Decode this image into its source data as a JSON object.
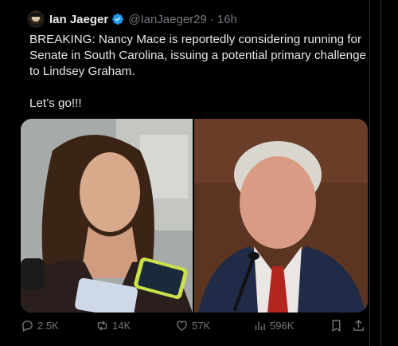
{
  "author": {
    "name": "Ian Jaeger",
    "handle": "@IanJaeger29",
    "separator": "·",
    "time": "16h"
  },
  "tweet": {
    "paragraph1": "BREAKING: Nancy Mace is reportedly considering running for Senate in South Carolina, issuing a potential primary challenge to Lindsey Graham.",
    "paragraph2": "Let’s go!!!"
  },
  "media": {
    "left_photo": "woman-speaking-to-reporters-photo",
    "right_photo": "man-at-hearing-photo"
  },
  "actions": {
    "replies": "2.5K",
    "reposts": "14K",
    "likes": "57K",
    "views": "596K"
  },
  "icons": {
    "verified": "verified-badge-icon",
    "reply": "reply-icon",
    "repost": "repost-icon",
    "like": "heart-icon",
    "views": "views-chart-icon",
    "bookmark": "bookmark-icon",
    "share": "share-icon"
  },
  "colors": {
    "background": "#000000",
    "text": "#e7e9ea",
    "muted": "#71767b",
    "verified": "#1d9bf0"
  }
}
